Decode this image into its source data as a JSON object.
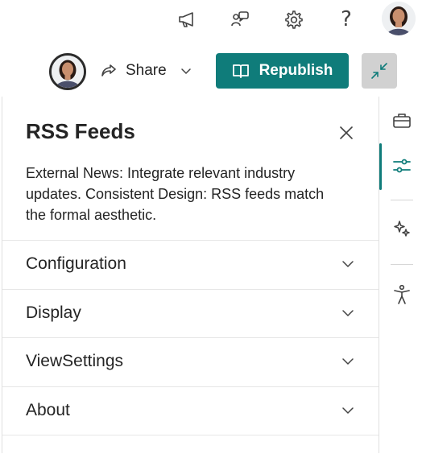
{
  "header": {
    "icons": [
      "megaphone-icon",
      "chat-bubbles-icon",
      "settings-icon",
      "help-icon"
    ],
    "help_label": "?"
  },
  "commandbar": {
    "share_label": "Share",
    "republish_label": "Republish",
    "accent": "#0f7c7a"
  },
  "panel": {
    "title": "RSS Feeds",
    "description": "External News: Integrate relevant industry updates. Consistent Design: RSS feeds match the formal aesthetic.",
    "sections": [
      {
        "label": "Configuration"
      },
      {
        "label": "Display"
      },
      {
        "label": "ViewSettings"
      },
      {
        "label": "About"
      }
    ]
  },
  "rail": {
    "items": [
      "toolbox-icon",
      "properties-sliders-icon",
      "sparkle-icon",
      "accessibility-icon"
    ],
    "active": "properties-sliders-icon"
  }
}
